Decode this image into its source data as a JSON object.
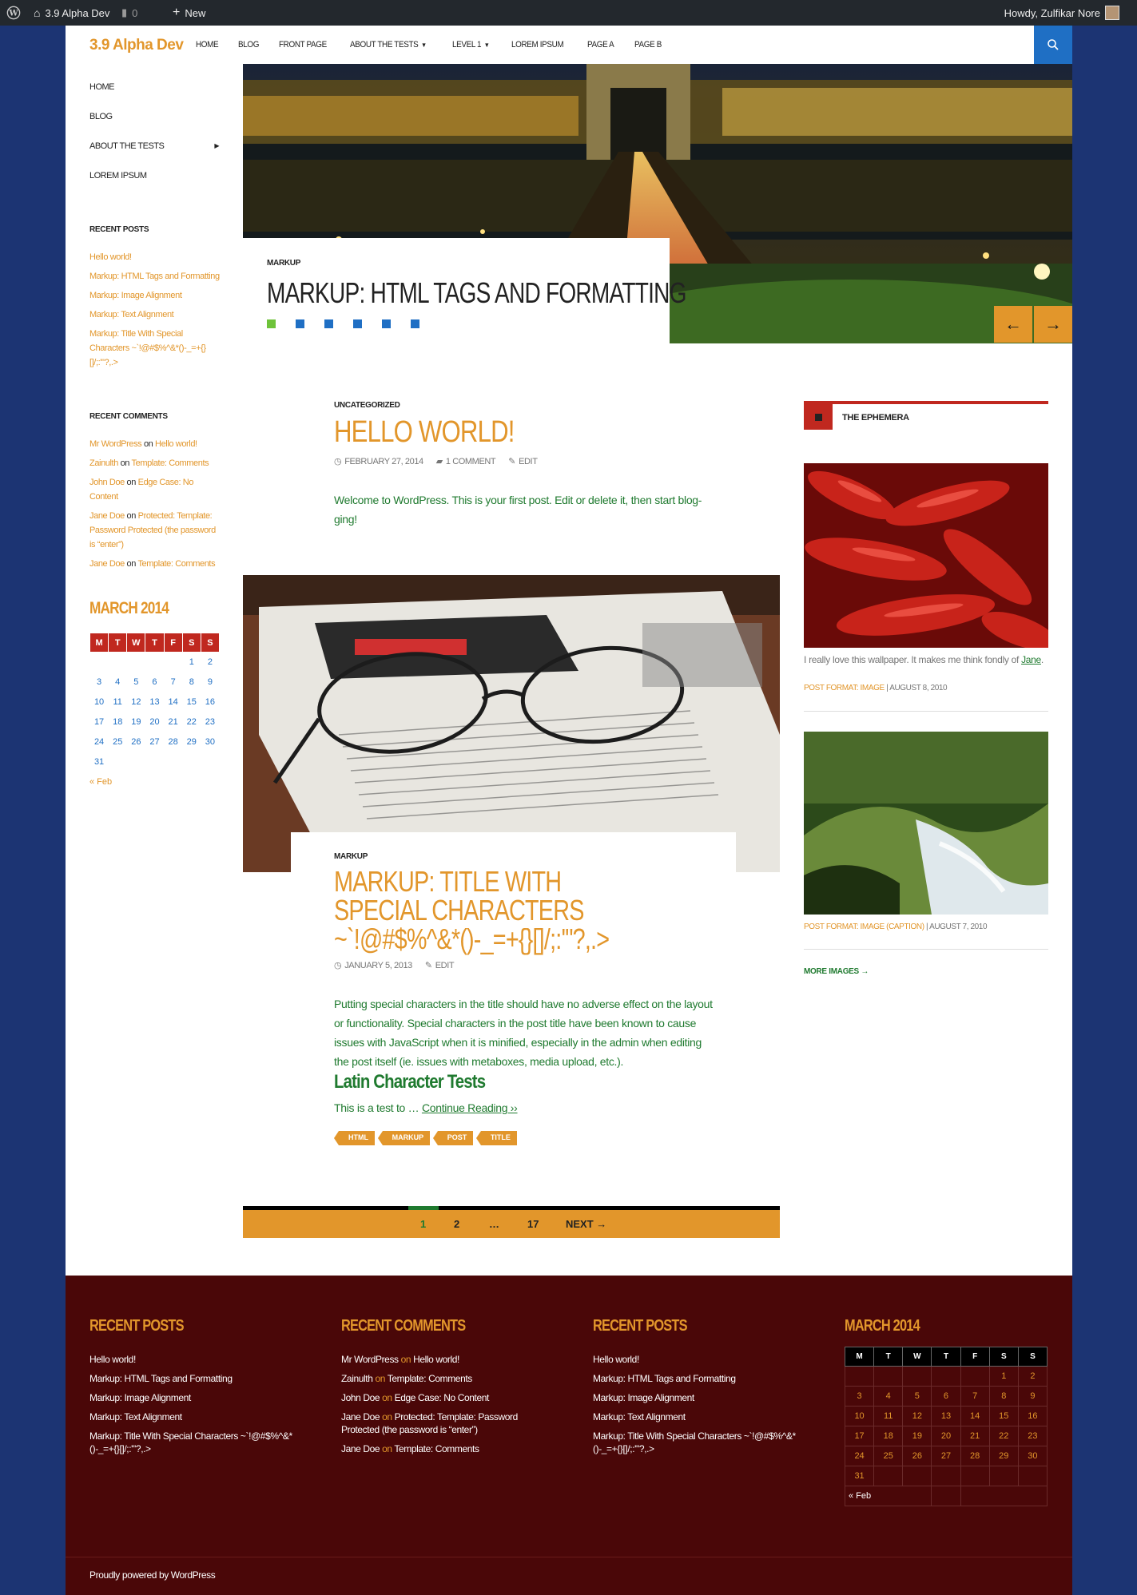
{
  "admin_bar": {
    "site_name": "3.9 Alpha Dev",
    "comments": "0",
    "new_label": "New",
    "howdy": "Howdy, Zulfikar Nore"
  },
  "header": {
    "site_title": "3.9 Alpha Dev",
    "nav": [
      "HOME",
      "BLOG",
      "FRONT PAGE",
      "ABOUT THE TESTS",
      "LEVEL 1",
      "LOREM IPSUM",
      "PAGE A",
      "PAGE B"
    ]
  },
  "left_nav": {
    "items": [
      "HOME",
      "BLOG",
      "ABOUT THE TESTS",
      "LOREM IPSUM"
    ]
  },
  "recent_posts": {
    "title": "RECENT POSTS",
    "items": [
      "Hello world!",
      "Markup: HTML Tags and Formatting",
      "Markup: Image Alignment",
      "Markup: Text Alignment",
      "Markup: Title With Special Characters ~`!@#$%^&*()-_=+{}[]/;:'\"?,.>"
    ]
  },
  "recent_comments": {
    "title": "RECENT COMMENTS",
    "on": "on",
    "items": [
      {
        "author": "Mr WordPress",
        "post": "Hello world!"
      },
      {
        "author": "Zainulth",
        "post": "Template: Comments"
      },
      {
        "author": "John Doe",
        "post": "Edge Case: No Content"
      },
      {
        "author": "Jane Doe",
        "post": "Protected: Template: Password Protected (the password is “enter”)"
      },
      {
        "author": "Jane Doe",
        "post": "Template: Comments"
      }
    ]
  },
  "calendar": {
    "title": "MARCH 2014",
    "days": [
      "M",
      "T",
      "W",
      "T",
      "F",
      "S",
      "S"
    ],
    "rows": [
      [
        "",
        "",
        "",
        "",
        "",
        "1",
        "2"
      ],
      [
        "3",
        "4",
        "5",
        "6",
        "7",
        "8",
        "9"
      ],
      [
        "10",
        "11",
        "12",
        "13",
        "14",
        "15",
        "16"
      ],
      [
        "17",
        "18",
        "19",
        "20",
        "21",
        "22",
        "23"
      ],
      [
        "24",
        "25",
        "26",
        "27",
        "28",
        "29",
        "30"
      ],
      [
        "31",
        "",
        "",
        "",
        "",
        "",
        ""
      ]
    ],
    "prev": "« Feb"
  },
  "featured": {
    "category": "MARKUP",
    "title": "MARKUP: HTML TAGS AND FORMATTING",
    "prev_arrow": "←",
    "next_arrow": "→"
  },
  "post1": {
    "category": "UNCATEGORIZED",
    "title": "HELLO WORLD!",
    "date": "FEBRUARY 27, 2014",
    "comments": "1 COMMENT",
    "edit": "EDIT",
    "content": "Welcome to WordPress. This is your first post. Edit or delete it, then start blog-ging!"
  },
  "post2": {
    "category": "MARKUP",
    "title": "MARKUP: TITLE WITH SPECIAL CHARACTERS ~`!@#$%^&*()-_=+{}[]/;:'\"?,.>",
    "date": "JANUARY 5, 2013",
    "edit": "EDIT",
    "content": "Putting special characters in the title should have no adverse effect on the layout or functionality. Special characters in the post title have been known to cause issues with JavaScript when it is minified, especially in the admin when editing the post itself (ie. issues with metaboxes, media upload, etc.).",
    "subheading": "Latin Character Tests",
    "excerpt": "This is a test to …",
    "continue": "Continue Reading ››",
    "tags": [
      "HTML",
      "MARKUP",
      "POST",
      "TITLE"
    ]
  },
  "pagination": {
    "items": [
      "1",
      "2",
      "…",
      "17"
    ],
    "next": "NEXT →"
  },
  "ephemera": {
    "title": "THE EPHEMERA",
    "item1": {
      "caption_pre": "I really love this wallpaper. It makes me think fondly of ",
      "caption_link": "Jane",
      "caption_post": ".",
      "format": "POST FORMAT: IMAGE",
      "date": "AUGUST 8, 2010"
    },
    "item2": {
      "format": "POST FORMAT: IMAGE (CAPTION)",
      "date": "AUGUST 7, 2010"
    },
    "more": "MORE IMAGES →"
  },
  "footer": {
    "credit": "Proudly powered by WordPress",
    "recent_posts_title_2": "RECENT POSTS"
  },
  "colors": {
    "accent": "#e2962b",
    "green": "#1f7a2f",
    "blue": "#1f6fc4",
    "footer_bg": "#4a0708",
    "body_bg": "#1c3473",
    "cal_red": "#c0281f"
  }
}
